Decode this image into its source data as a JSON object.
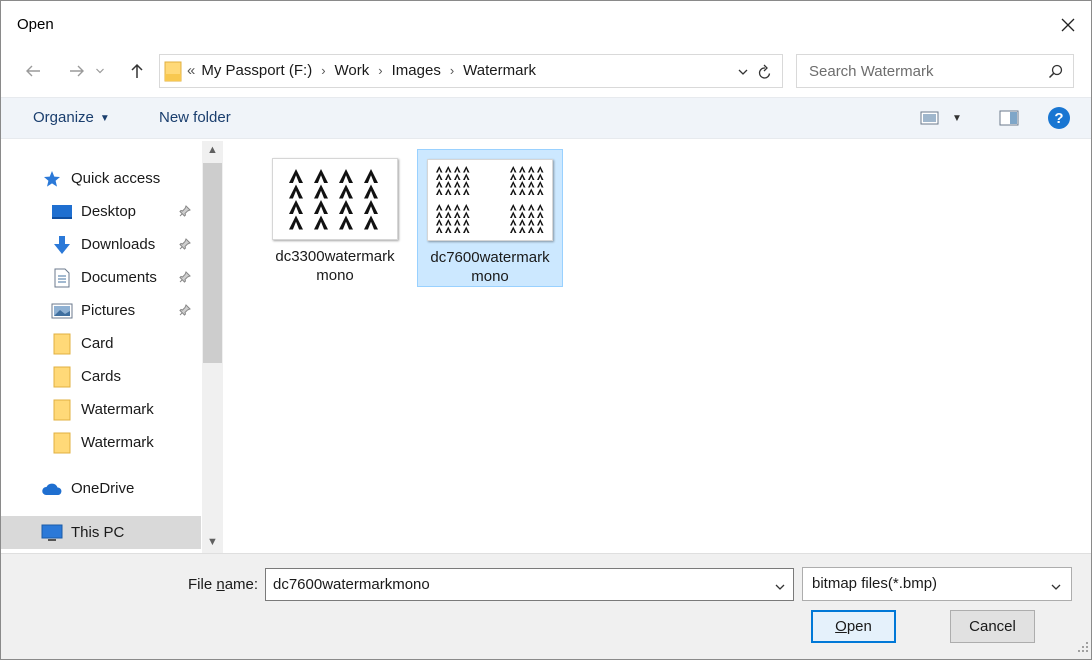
{
  "window": {
    "title": "Open"
  },
  "nav": {
    "breadcrumb_overflow": "«",
    "breadcrumbs": [
      "My Passport (F:)",
      "Work",
      "Images",
      "Watermark"
    ],
    "search_placeholder": "Search Watermark"
  },
  "toolbar": {
    "organize_label": "Organize",
    "new_folder_label": "New folder",
    "help_label": "?"
  },
  "sidebar": {
    "items": [
      {
        "label": "Quick access",
        "icon": "star-icon",
        "pinned": false
      },
      {
        "label": "Desktop",
        "icon": "desktop-icon",
        "pinned": true
      },
      {
        "label": "Downloads",
        "icon": "download-arrow-icon",
        "pinned": true
      },
      {
        "label": "Documents",
        "icon": "document-icon",
        "pinned": true
      },
      {
        "label": "Pictures",
        "icon": "pictures-icon",
        "pinned": true
      },
      {
        "label": "Card",
        "icon": "folder-icon",
        "pinned": false
      },
      {
        "label": "Cards",
        "icon": "folder-icon",
        "pinned": false
      },
      {
        "label": "Watermark",
        "icon": "folder-icon",
        "pinned": false
      },
      {
        "label": "Watermark",
        "icon": "folder-icon",
        "pinned": false
      },
      {
        "label": "OneDrive",
        "icon": "cloud-icon",
        "pinned": false
      },
      {
        "label": "This PC",
        "icon": "computer-icon",
        "pinned": false,
        "selected": true
      }
    ]
  },
  "files": [
    {
      "name": "dc3300watermarkmono",
      "selected": false
    },
    {
      "name": "dc7600watermarkmono",
      "selected": true
    }
  ],
  "footer": {
    "file_name_label_pre": "File ",
    "file_name_label_accel": "n",
    "file_name_label_post": "ame:",
    "file_name_value": "dc7600watermarkmono",
    "file_type_value": "bitmap files(*.bmp)",
    "open_accel": "O",
    "open_rest": "pen",
    "cancel_label": "Cancel"
  },
  "colors": {
    "accent": "#0078d7",
    "selection": "#cce8ff",
    "toolbar_bg": "#f0f4f9",
    "footer_bg": "#f0f0f0"
  }
}
